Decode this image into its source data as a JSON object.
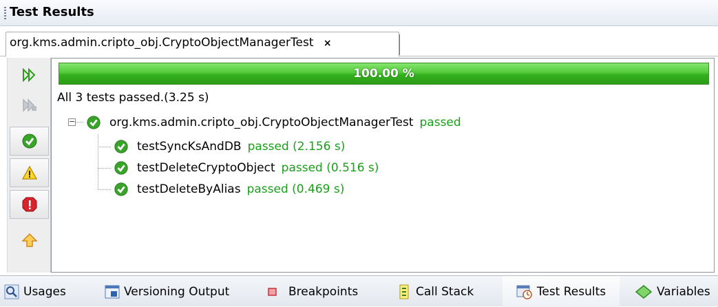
{
  "window": {
    "title": "Test Results"
  },
  "tabs": [
    {
      "label": "org.kms.admin.cripto_obj.CryptoObjectManagerTest",
      "close_glyph": "×"
    }
  ],
  "toolbar": {
    "buttons": [
      {
        "name": "rerun-icon",
        "tooltip": ""
      },
      {
        "name": "rerun-failed-icon",
        "tooltip": ""
      },
      {
        "name": "show-passed-icon",
        "toggled": true
      },
      {
        "name": "show-warnings-icon",
        "toggled": true
      },
      {
        "name": "show-failures-icon",
        "toggled": true
      },
      {
        "name": "move-up-icon"
      }
    ]
  },
  "progress": {
    "value": 1.0,
    "label": "100.00 %",
    "color": "#35b11f"
  },
  "results": {
    "summary": "All 3 tests passed.(3.25 s)",
    "suite": {
      "name": "org.kms.admin.cripto_obj.CryptoObjectManagerTest",
      "status": "passed"
    },
    "tests": [
      {
        "name": "testSyncKsAndDB",
        "status": "passed (2.156 s)"
      },
      {
        "name": "testDeleteCryptoObject",
        "status": "passed (0.516 s)"
      },
      {
        "name": "testDeleteByAlias",
        "status": "passed (0.469 s)"
      }
    ]
  },
  "statusbar": {
    "items": [
      {
        "label": "Usages",
        "icon": "usages-icon"
      },
      {
        "label": "Versioning Output",
        "icon": "versioning-output-icon"
      },
      {
        "label": "Breakpoints",
        "icon": "breakpoints-icon"
      },
      {
        "label": "Call Stack",
        "icon": "call-stack-icon"
      },
      {
        "label": "Test Results",
        "icon": "test-results-icon",
        "active": true
      },
      {
        "label": "Variables",
        "icon": "variables-icon"
      }
    ]
  },
  "colors": {
    "pass_text": "#19a019",
    "accent_green": "#3aa42a"
  }
}
